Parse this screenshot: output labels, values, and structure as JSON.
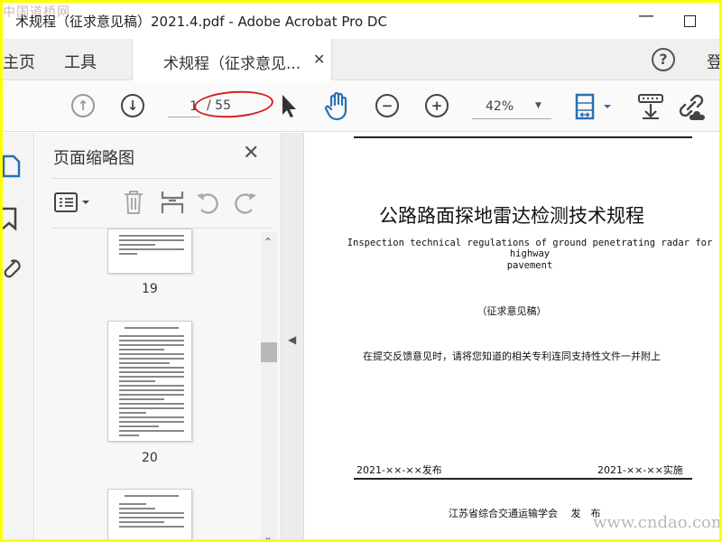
{
  "window": {
    "title": "术规程（征求意见稿）2021.4.pdf - Adobe Acrobat Pro DC",
    "minimize": "—"
  },
  "watermark": {
    "top": "中国道桥网",
    "bottom": "www.cndao.com"
  },
  "tabs": {
    "home": "主页",
    "tools": "工具",
    "doc": "术规程（征求意见...",
    "doc_close": "✕",
    "help": "?",
    "signin": "登"
  },
  "toolbar": {
    "page_current": "1",
    "page_total": "/ 55",
    "zoom": "42%",
    "zoom_dropdown": "▼"
  },
  "panel": {
    "title": "页面缩略图",
    "close": "✕",
    "thumbnails": [
      {
        "page": "19"
      },
      {
        "page": "20"
      }
    ]
  },
  "document": {
    "title_cn": "公路路面探地雷达检测技术规程",
    "title_en_line1": "Inspection technical regulations of ground penetrating radar for highway",
    "title_en_line2": "pavement",
    "draft_label": "（征求意见稿）",
    "note": "在提交反馈意见时，请将您知道的相关专利连同支持性文件一并附上",
    "release_date": "2021-××-××发布",
    "effective_date": "2021-××-××实施",
    "publisher": "江苏省综合交通运输学会　 发　布"
  },
  "colors": {
    "outer_border": "#ffff00",
    "hand_tool": "#2a6fb5",
    "annotation_ellipse": "#d42020"
  },
  "icons": [
    "prev-page-icon",
    "next-page-icon",
    "select-cursor-icon",
    "hand-tool-icon",
    "zoom-out-icon",
    "zoom-in-icon",
    "fit-page-icon",
    "scroll-mode-icon",
    "link-icon",
    "page-thumbnail-icon",
    "bookmark-icon",
    "attachment-icon",
    "options-icon",
    "delete-icon",
    "insert-icon",
    "undo-icon",
    "redo-icon"
  ]
}
